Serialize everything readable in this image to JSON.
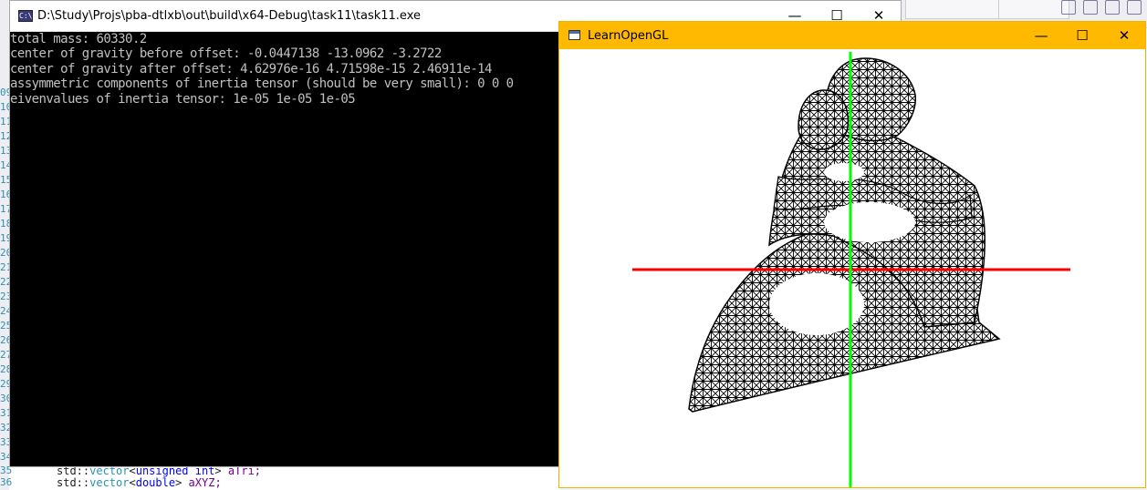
{
  "ide": {
    "line_numbers": [
      "09",
      "10",
      "11",
      "12",
      "13",
      "14",
      "15",
      "16",
      "17",
      "18",
      "19",
      "20",
      "21",
      "22",
      "23",
      "24",
      "25",
      "26",
      "27",
      "28",
      "29",
      "30",
      "31",
      "32",
      "33",
      "34"
    ],
    "code_lines": [
      {
        "num": "35",
        "prefix": "std::",
        "type": "vector",
        "open": "<",
        "tparam": "unsigned int",
        "close": ">",
        "name": "aTri;"
      },
      {
        "num": "36",
        "prefix": "std::",
        "type": "vector",
        "open": "<",
        "tparam": "double",
        "close": ">",
        "name": "aXYZ;"
      }
    ]
  },
  "console": {
    "icon_label": "C:\\",
    "title": "D:\\Study\\Projs\\pba-dtlxb\\out\\build\\x64-Debug\\task11\\task11.exe",
    "minimize_glyph": "—",
    "maximize_glyph": "☐",
    "close_glyph": "✕",
    "output_lines": [
      "total mass: 60330.2",
      "center of gravity before offset: -0.0447138 -13.0962 -3.2722",
      "center of gravity after offset: 4.62976e-16 4.71598e-15 2.46911e-14",
      "assymmetric components of inertia tensor (should be very small): 0 0 0",
      "eivenvalues of inertia tensor: 1e-05 1e-05 1e-05"
    ]
  },
  "gl_window": {
    "title": "LearnOpenGL",
    "minimize_glyph": "—",
    "maximize_glyph": "☐",
    "close_glyph": "✕",
    "axis_colors": {
      "x_axis": "#ff0000",
      "y_axis": "#00ff00"
    },
    "mesh_color": "#000000"
  }
}
